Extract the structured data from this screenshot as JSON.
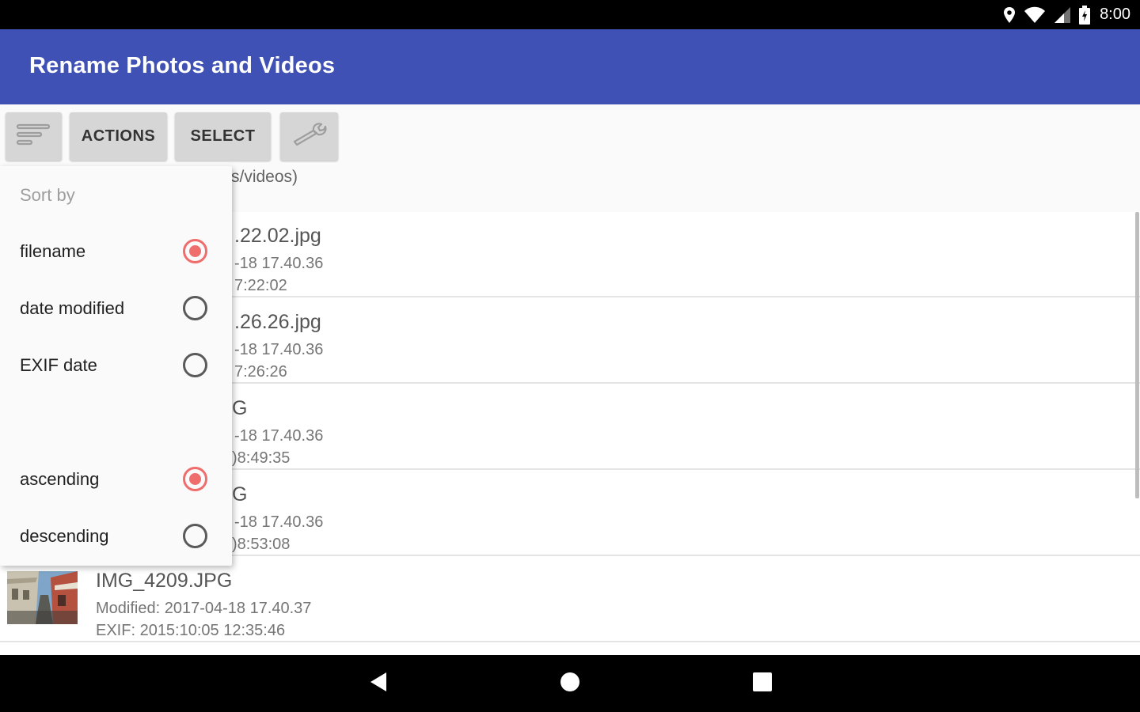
{
  "status_bar": {
    "time": "8:00",
    "icons": [
      "location-icon",
      "wifi-icon",
      "signal-icon",
      "battery-icon"
    ]
  },
  "app_bar": {
    "title": "Rename Photos and Videos",
    "color": "#3f51b5"
  },
  "toolbar": {
    "sort_icon": "sort-lines-icon",
    "actions_label": "ACTIONS",
    "select_label": "SELECT",
    "settings_icon": "wrench-icon"
  },
  "header": {
    "visible_text": "s/videos)"
  },
  "file_list": [
    {
      "name": ".22.02.jpg",
      "modified": "-18 17.40.36",
      "exif": "7:22:02"
    },
    {
      "name": ".26.26.jpg",
      "modified": "-18 17.40.36",
      "exif": "7:26:26"
    },
    {
      "name": "G",
      "modified": "-18 17.40.36",
      "exif": ")8:49:35"
    },
    {
      "name": "G",
      "modified": "-18 17.40.36",
      "exif": ")8:53:08"
    },
    {
      "name": "IMG_4209.JPG",
      "modified": "Modified: 2017-04-18 17.40.37",
      "exif": "EXIF: 2015:10:05 12:35:46"
    }
  ],
  "sort_popup": {
    "title": "Sort by",
    "options": [
      {
        "label": "filename",
        "checked": true
      },
      {
        "label": "date modified",
        "checked": false
      },
      {
        "label": "EXIF date",
        "checked": false
      }
    ],
    "order_options": [
      {
        "label": "ascending",
        "checked": true
      },
      {
        "label": "descending",
        "checked": false
      }
    ],
    "accent_color": "#f06d6d"
  },
  "nav_bar": {
    "buttons": [
      "back-icon",
      "home-icon",
      "recents-icon"
    ]
  }
}
